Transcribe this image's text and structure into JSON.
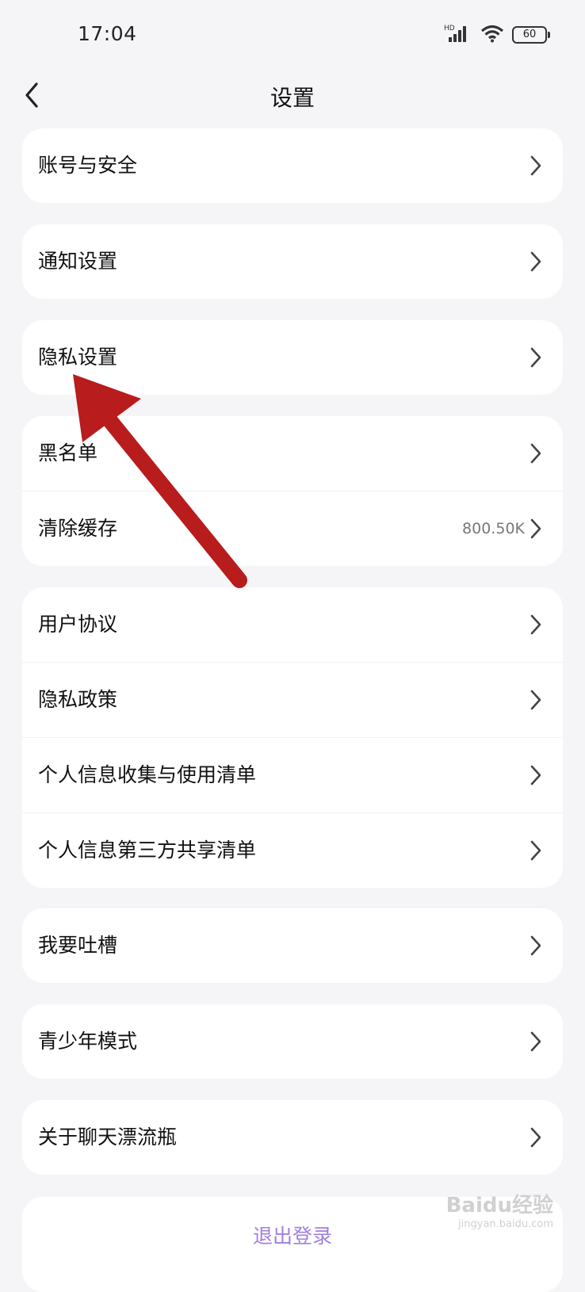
{
  "status_bar": {
    "time": "17:04",
    "battery": "60",
    "network": "HD"
  },
  "header": {
    "title": "设置"
  },
  "groups": [
    {
      "items": [
        {
          "label": "账号与安全",
          "value": ""
        }
      ]
    },
    {
      "items": [
        {
          "label": "通知设置",
          "value": ""
        }
      ]
    },
    {
      "items": [
        {
          "label": "隐私设置",
          "value": ""
        }
      ]
    },
    {
      "items": [
        {
          "label": "黑名单",
          "value": ""
        },
        {
          "label": "清除缓存",
          "value": "800.50K"
        }
      ]
    },
    {
      "items": [
        {
          "label": "用户协议",
          "value": ""
        },
        {
          "label": "隐私政策",
          "value": ""
        },
        {
          "label": "个人信息收集与使用清单",
          "value": ""
        },
        {
          "label": "个人信息第三方共享清单",
          "value": ""
        }
      ]
    },
    {
      "items": [
        {
          "label": "我要吐槽",
          "value": ""
        }
      ]
    },
    {
      "items": [
        {
          "label": "青少年模式",
          "value": ""
        }
      ]
    },
    {
      "items": [
        {
          "label": "关于聊天漂流瓶",
          "value": ""
        }
      ]
    }
  ],
  "logout_label": "退出登录",
  "watermark": {
    "brand": "Baidu经验",
    "url": "jingyan.baidu.com"
  },
  "colors": {
    "accent": "#a07fe0",
    "annotation_arrow": "#b81c1c",
    "background": "#f5f5f7"
  }
}
